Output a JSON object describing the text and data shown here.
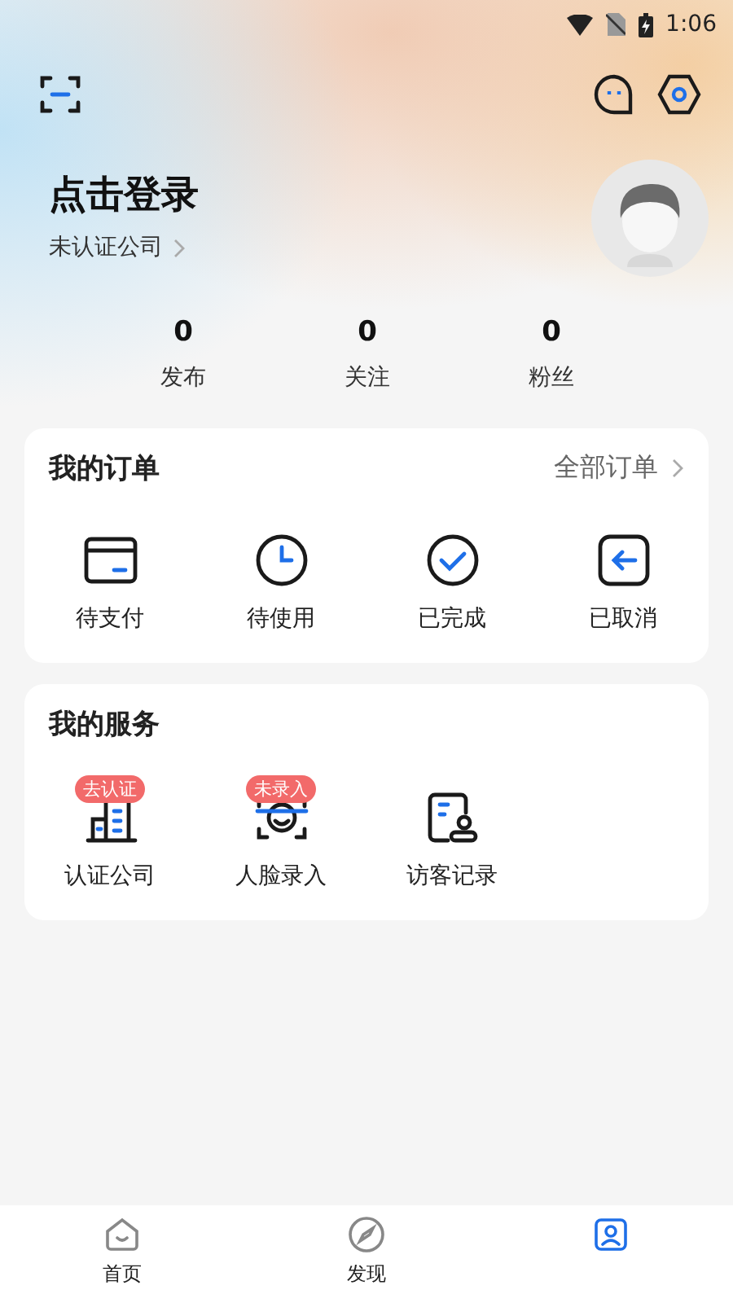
{
  "status_bar": {
    "time": "1:06"
  },
  "profile": {
    "title": "点击登录",
    "company": "未认证公司"
  },
  "stats": [
    {
      "value": "0",
      "label": "发布"
    },
    {
      "value": "0",
      "label": "关注"
    },
    {
      "value": "0",
      "label": "粉丝"
    }
  ],
  "orders": {
    "title": "我的订单",
    "link": "全部订单",
    "items": [
      {
        "kind": "card",
        "label": "待支付"
      },
      {
        "kind": "clock",
        "label": "待使用"
      },
      {
        "kind": "check",
        "label": "已完成"
      },
      {
        "kind": "back",
        "label": "已取消"
      }
    ]
  },
  "services": {
    "title": "我的服务",
    "items": [
      {
        "kind": "building",
        "label": "认证公司",
        "badge": "去认证"
      },
      {
        "kind": "face",
        "label": "人脸录入",
        "badge": "未录入"
      },
      {
        "kind": "visitor",
        "label": "访客记录"
      }
    ]
  },
  "tab_bar": [
    {
      "kind": "home",
      "label": "首页",
      "selected": false
    },
    {
      "kind": "discover",
      "label": "发现",
      "selected": false
    },
    {
      "kind": "me",
      "selected": true
    }
  ]
}
